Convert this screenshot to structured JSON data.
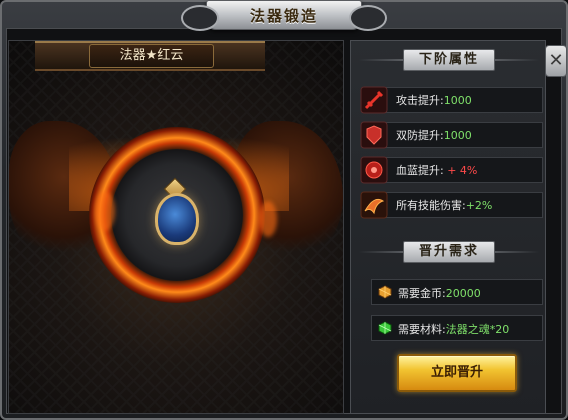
{
  "window": {
    "title": "法器锻造"
  },
  "item": {
    "name": "法器★红云"
  },
  "next_attributes": {
    "title": "下阶属性",
    "items": [
      {
        "label": "攻击提升:",
        "value": "1000",
        "value_color": "green",
        "icon": "sword-attack-icon"
      },
      {
        "label": "双防提升:",
        "value": "1000",
        "value_color": "green",
        "icon": "armor-defense-icon"
      },
      {
        "label": "血蓝提升:",
        "value": " + 4%",
        "value_color": "red",
        "icon": "blood-mana-icon"
      },
      {
        "label": "所有技能伤害:",
        "value": "+2%",
        "value_color": "green",
        "icon": "skill-damage-icon"
      }
    ]
  },
  "requirements": {
    "title": "晋升需求",
    "items": [
      {
        "label": "需要金币:",
        "value": "20000",
        "icon": "gold-coin-icon"
      },
      {
        "label": "需要材料:",
        "value": "法器之魂*20",
        "icon": "green-gem-icon"
      }
    ]
  },
  "actions": {
    "upgrade_label": "立即晋升",
    "close_label": "✕"
  },
  "colors": {
    "accent_gold": "#f2c431",
    "value_green": "#7fe06a",
    "value_red": "#ff4a4a",
    "fire": "#ff8a1a"
  }
}
